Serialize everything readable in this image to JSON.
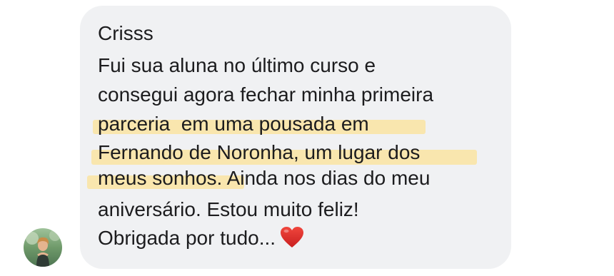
{
  "message": {
    "sender": "Crisss",
    "lines": [
      "Fui sua aluna no último curso e",
      "consegui agora fechar minha primeira",
      "parceria  em uma pousada em",
      "Fernando de Noronha, um lugar dos",
      "meus sonhos.",
      " Ainda nos dias do meu",
      "aniversário. Estou muito feliz!",
      "Obrigada por tudo..."
    ],
    "emoji": "heart-emoji"
  },
  "avatar": {
    "icon": "profile-photo"
  },
  "colors": {
    "bubble": "#f0f1f3",
    "text": "#1c1c1e",
    "highlight": "#f9e6ae",
    "heart": "#e5322d"
  }
}
